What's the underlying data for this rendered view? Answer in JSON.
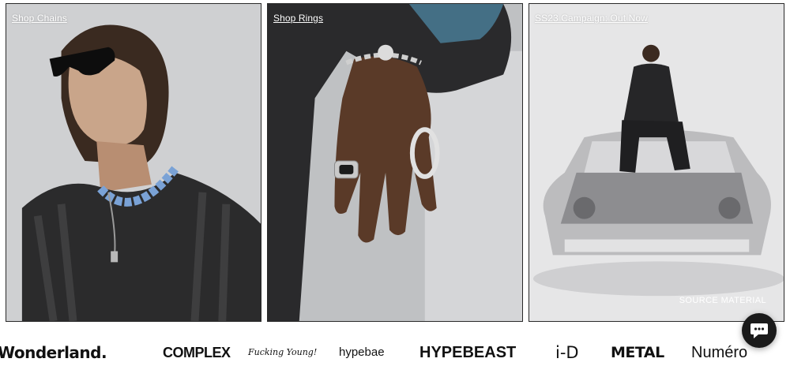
{
  "panels": [
    {
      "link": "Shop Chains"
    },
    {
      "link": "Shop Rings"
    },
    {
      "link": "SS23 Campaign: Out Now",
      "caption": "SOURCE MATERIAL"
    }
  ],
  "press": [
    "Wonderland.",
    "COMPLEX",
    "Fucking Young!",
    "hypebae",
    "HYPEBEAST",
    "i-D",
    "METAL",
    "Numéro"
  ],
  "chat": {
    "icon": "chat-bubble-icon"
  }
}
